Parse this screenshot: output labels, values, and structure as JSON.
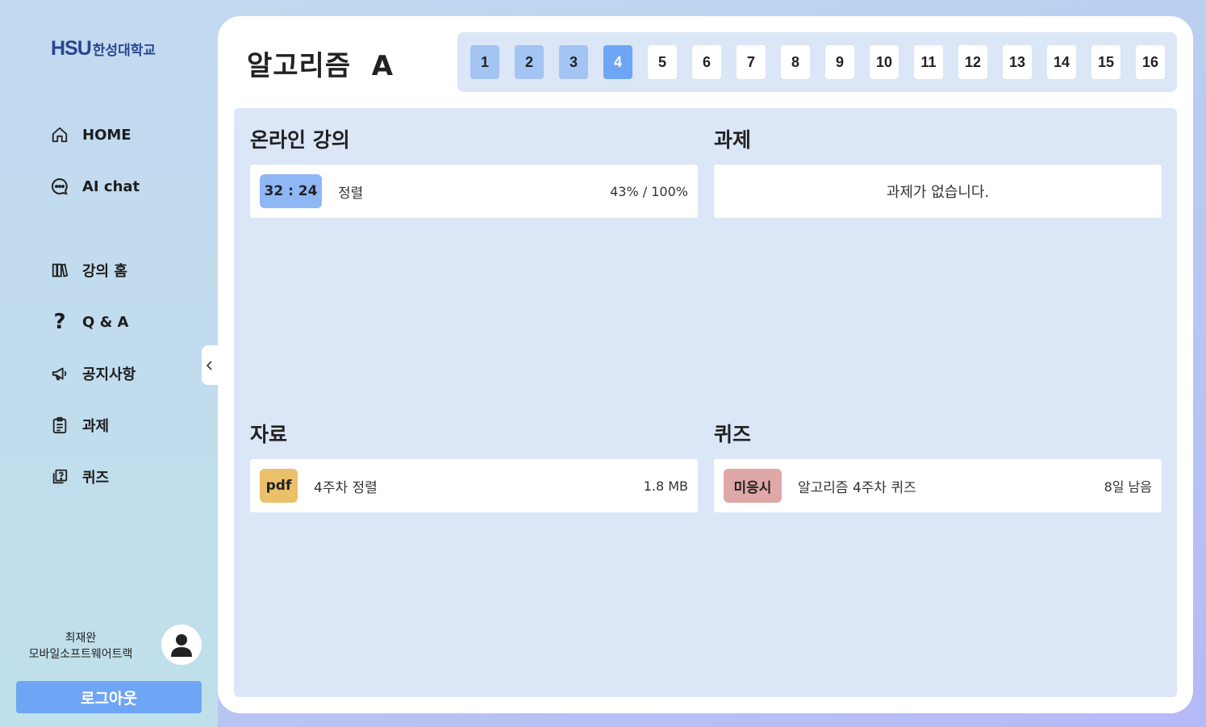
{
  "brand": {
    "mark": "HSU",
    "name": "한성대학교",
    "color": "#2a4690"
  },
  "sidebar": {
    "items": [
      {
        "label": "HOME",
        "icon": "home-icon"
      },
      {
        "label": "AI chat",
        "icon": "chat-bubble-icon"
      },
      {
        "label": "강의 홈",
        "icon": "books-icon"
      },
      {
        "label": "Q & A",
        "icon": "question-mark-icon"
      },
      {
        "label": "공지사항",
        "icon": "megaphone-icon"
      },
      {
        "label": "과제",
        "icon": "clipboard-icon"
      },
      {
        "label": "퀴즈",
        "icon": "quiz-icon"
      }
    ],
    "user": {
      "name": "최재완",
      "department": "모바일소프트웨어트랙"
    },
    "logout_label": "로그아웃"
  },
  "course": {
    "title": "알고리즘  A",
    "weeks": [
      "1",
      "2",
      "3",
      "4",
      "5",
      "6",
      "7",
      "8",
      "9",
      "10",
      "11",
      "12",
      "13",
      "14",
      "15",
      "16"
    ],
    "completed_weeks": [
      "1",
      "2",
      "3"
    ],
    "current_week": "4"
  },
  "sections": {
    "online_lecture": {
      "title": "온라인 강의",
      "items": [
        {
          "duration": "32 : 24",
          "name": "정렬",
          "progress": "43% / 100%"
        }
      ]
    },
    "assignment": {
      "title": "과제",
      "empty_message": "과제가 없습니다."
    },
    "materials": {
      "title": "자료",
      "items": [
        {
          "type": "pdf",
          "name": "4주차 정렬",
          "size": "1.8 MB"
        }
      ]
    },
    "quiz": {
      "title": "퀴즈",
      "items": [
        {
          "status": "미응시",
          "name": "알고리즘 4주차 퀴즈",
          "remaining": "8일 남음"
        }
      ]
    }
  },
  "colors": {
    "accent": "#6ea6f5",
    "completed_week": "#a4c4f4",
    "panel": "#dbe6f7",
    "pdf_badge": "#ebc06a",
    "duration_badge": "#8fb7f5",
    "quiz_status_badge": "#e0a7a7"
  }
}
